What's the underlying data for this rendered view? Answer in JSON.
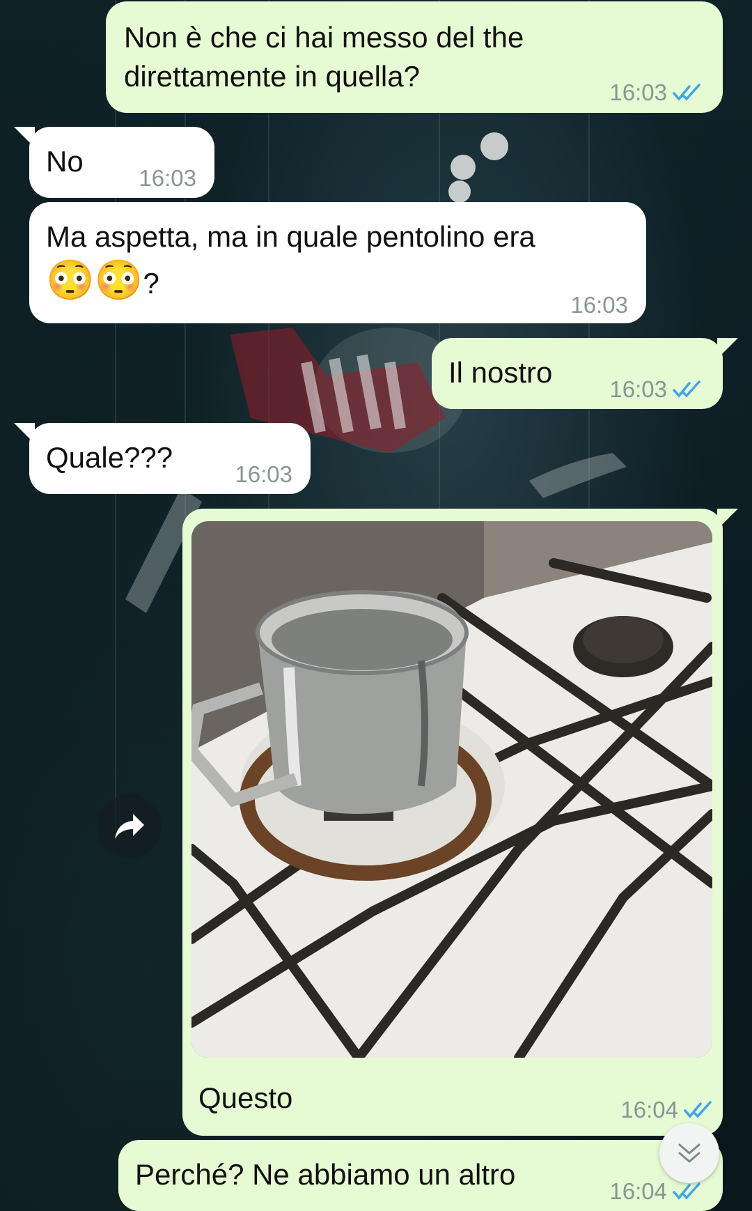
{
  "messages": [
    {
      "id": "m1",
      "direction": "outgoing",
      "text_line1": "Non è che ci hai messo del the",
      "text_line2": "direttamente in quella?",
      "time": "16:03",
      "status": "read"
    },
    {
      "id": "m2",
      "direction": "incoming",
      "text": "No",
      "time": "16:03"
    },
    {
      "id": "m3",
      "direction": "incoming",
      "text_line1": "Ma aspetta, ma in quale pentolino era",
      "text_line2": "?",
      "emoji": "😳😳",
      "time": "16:03"
    },
    {
      "id": "m4",
      "direction": "outgoing",
      "text": "Il nostro",
      "time": "16:03",
      "status": "read"
    },
    {
      "id": "m5",
      "direction": "incoming",
      "text": "Quale???",
      "time": "16:03"
    },
    {
      "id": "m6",
      "direction": "outgoing",
      "type": "image",
      "caption": "Questo",
      "time": "16:04",
      "status": "read"
    },
    {
      "id": "m7",
      "direction": "outgoing",
      "text": "Perché? Ne abbiamo un altro",
      "time": "16:04",
      "status": "read"
    }
  ],
  "icons": {
    "forward": "forward-arrow-icon",
    "scroll_down": "double-chevron-down-icon",
    "read_receipt": "double-check-icon"
  },
  "colors": {
    "outgoing_bubble": "#e6fbd3",
    "incoming_bubble": "#ffffff",
    "read_tick": "#3ea6e8",
    "timestamp": "#8a9594"
  }
}
